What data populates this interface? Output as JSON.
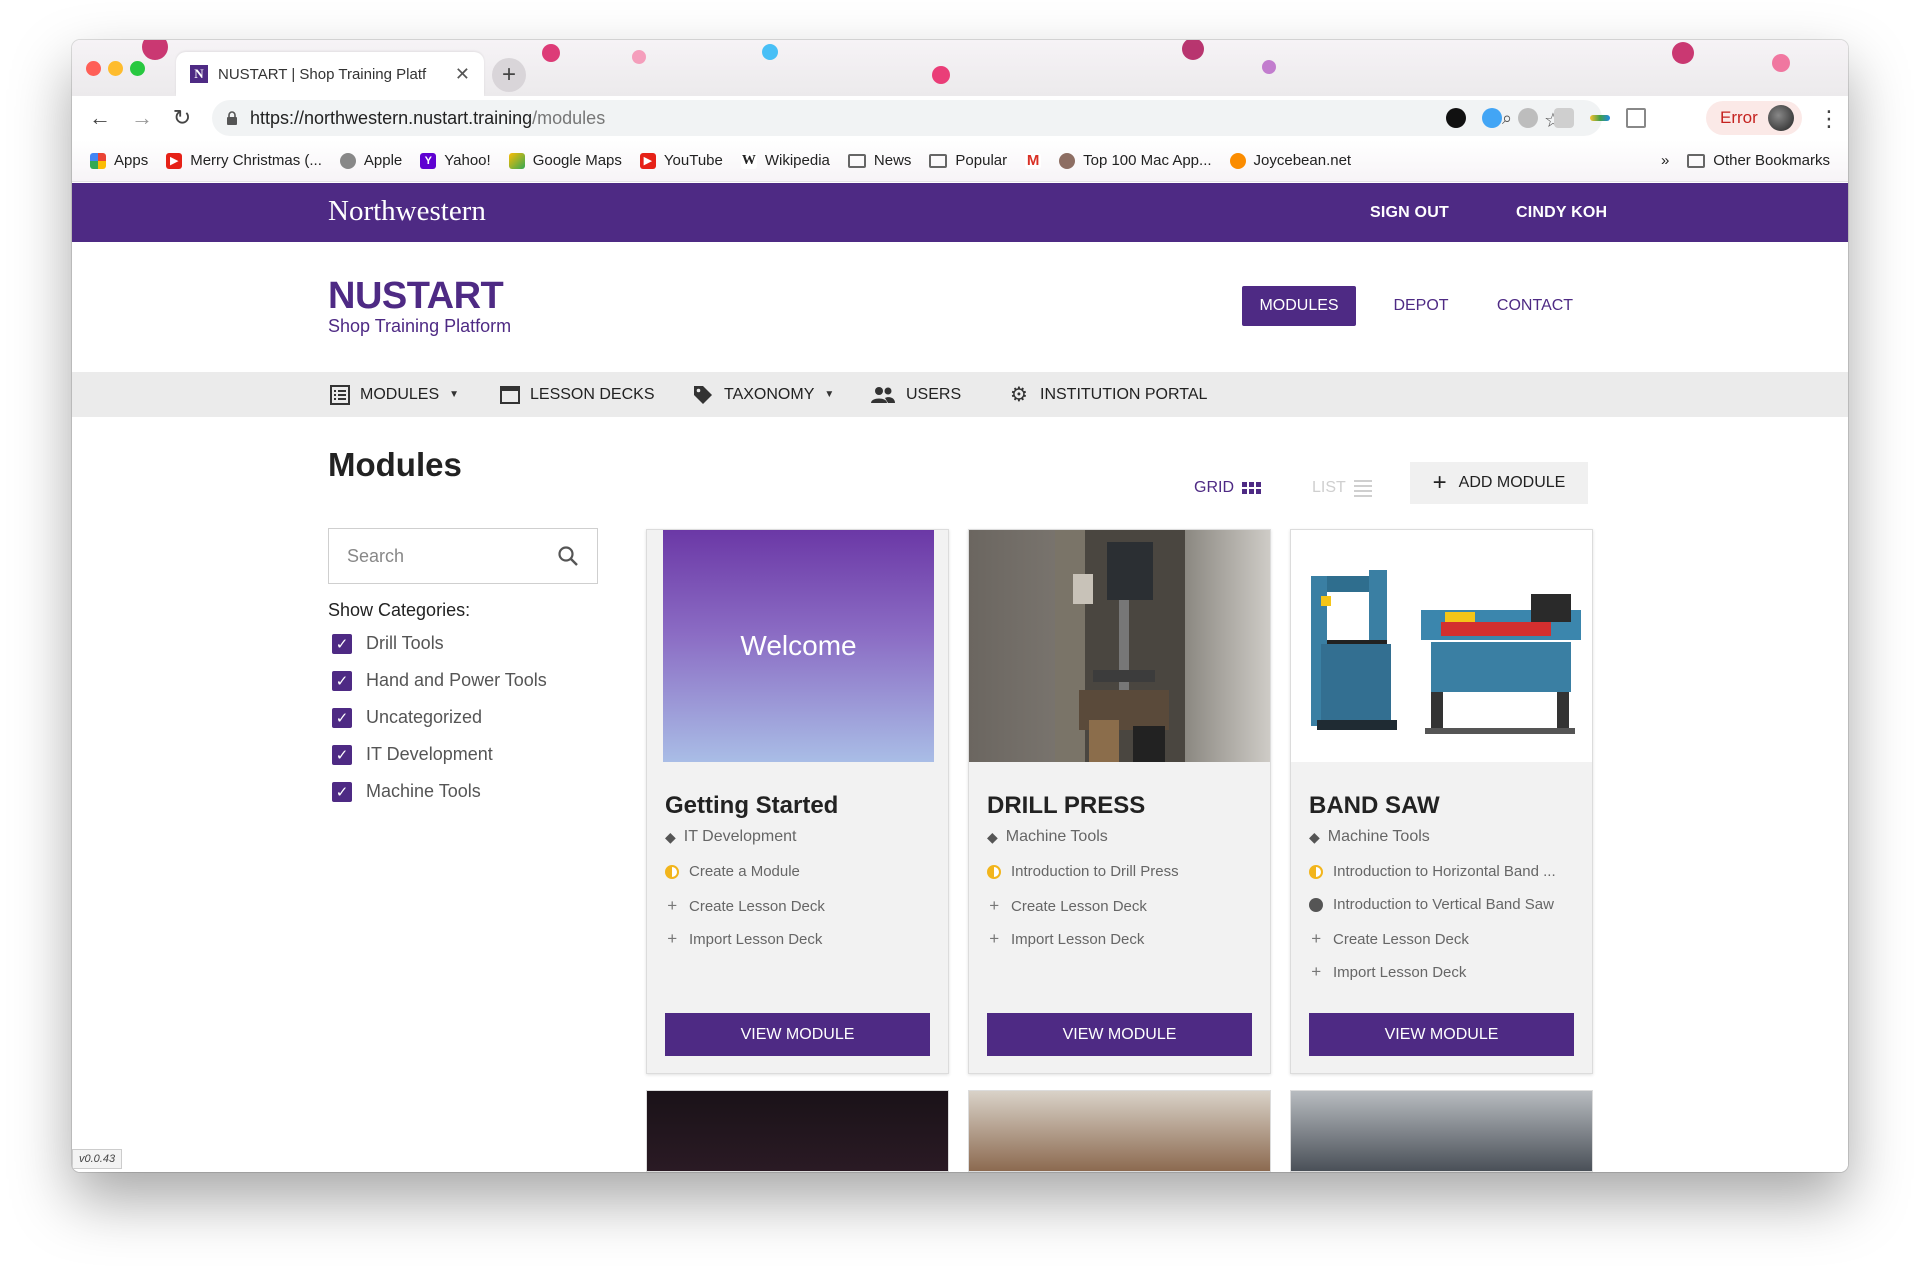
{
  "browser": {
    "tab_title": "NUSTART | Shop Training Platf",
    "tab_favicon": "N",
    "url_host": "https://northwestern.nustart.training",
    "url_path": "/modules",
    "error_label": "Error",
    "bookmarks": [
      {
        "label": "Apps",
        "icon": "apps-grid-icon"
      },
      {
        "label": "Merry Christmas (...",
        "icon": "youtube-icon"
      },
      {
        "label": "Apple",
        "icon": "apple-icon"
      },
      {
        "label": "Yahoo!",
        "icon": "yahoo-icon"
      },
      {
        "label": "Google Maps",
        "icon": "maps-icon"
      },
      {
        "label": "YouTube",
        "icon": "youtube-icon"
      },
      {
        "label": "Wikipedia",
        "icon": "wikipedia-icon"
      },
      {
        "label": "News",
        "icon": "folder-icon"
      },
      {
        "label": "Popular",
        "icon": "folder-icon"
      },
      {
        "label": "",
        "icon": "gmail-icon"
      },
      {
        "label": "Top 100 Mac App...",
        "icon": "site-icon"
      },
      {
        "label": "Joycebean.net",
        "icon": "site-icon"
      }
    ],
    "overflow": "»",
    "other_bookmarks": "Other Bookmarks"
  },
  "site": {
    "logo": "Northwestern",
    "sign_out": "SIGN OUT",
    "user_name": "CINDY KOH",
    "brand_title": "NUSTART",
    "brand_subtitle": "Shop Training Platform",
    "main_nav": [
      "MODULES",
      "DEPOT",
      "CONTACT"
    ],
    "sub_nav": [
      "MODULES",
      "LESSON DECKS",
      "TAXONOMY",
      "USERS",
      "INSTITUTION PORTAL"
    ],
    "page_title": "Modules",
    "view_grid": "GRID",
    "view_list": "LIST",
    "add_module": "ADD MODULE",
    "search_placeholder": "Search",
    "show_categories": "Show Categories:",
    "categories": [
      "Drill Tools",
      "Hand and Power Tools",
      "Uncategorized",
      "IT Development",
      "Machine Tools"
    ],
    "version": "v0.0.43"
  },
  "cards": [
    {
      "image_text": "Welcome",
      "title": "Getting Started",
      "category": "IT Development",
      "lessons": [
        {
          "label": "Create a Module",
          "status": "in-progress"
        },
        {
          "label": "Create Lesson Deck",
          "status": "add"
        },
        {
          "label": "Import Lesson Deck",
          "status": "add"
        }
      ],
      "button": "VIEW MODULE"
    },
    {
      "title": "DRILL PRESS",
      "category": "Machine Tools",
      "lessons": [
        {
          "label": "Introduction to Drill Press",
          "status": "in-progress"
        },
        {
          "label": "Create Lesson Deck",
          "status": "add"
        },
        {
          "label": "Import Lesson Deck",
          "status": "add"
        }
      ],
      "button": "VIEW MODULE"
    },
    {
      "title": "BAND SAW",
      "category": "Machine Tools",
      "lessons": [
        {
          "label": "Introduction to Horizontal Band ...",
          "status": "in-progress"
        },
        {
          "label": "Introduction to Vertical Band Saw",
          "status": "not-started"
        },
        {
          "label": "Create Lesson Deck",
          "status": "add"
        },
        {
          "label": "Import Lesson Deck",
          "status": "add"
        }
      ],
      "button": "VIEW MODULE"
    }
  ],
  "colors": {
    "brand_purple": "#4e2a84",
    "progress_yellow": "#f2b51c"
  }
}
